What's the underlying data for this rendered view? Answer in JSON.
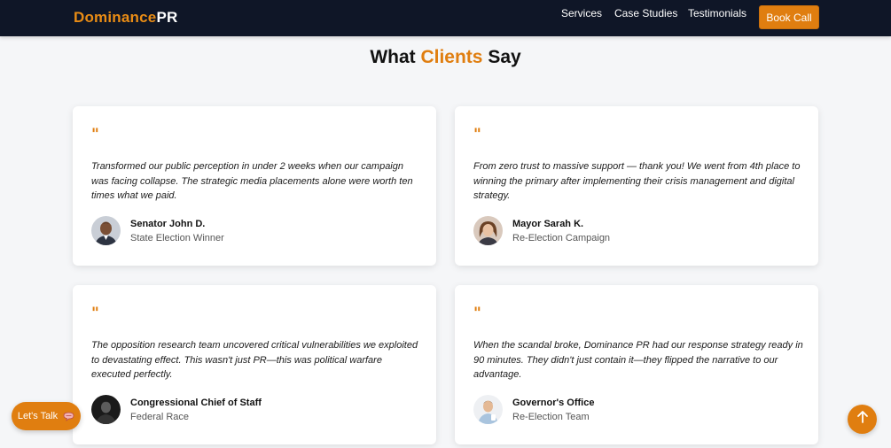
{
  "nav": {
    "logo_part1": "Dominance",
    "logo_part2": "PR",
    "links": [
      "Services",
      "Case Studies",
      "Testimonials"
    ],
    "cta_label": "Book Call"
  },
  "section": {
    "title_before": "What ",
    "title_accent": "Clients",
    "title_after": " Say"
  },
  "testimonials": [
    {
      "quote_mark": "\"",
      "quote": "Transformed our public perception in under 2 weeks when our campaign was facing collapse. The strategic media placements alone were worth ten times what we paid.",
      "name": "Senator John D.",
      "role": "State Election Winner"
    },
    {
      "quote_mark": "\"",
      "quote": "From zero trust to massive support — thank you! We went from 4th place to winning the primary after implementing their crisis management and digital strategy.",
      "name": "Mayor Sarah K.",
      "role": "Re-Election Campaign"
    },
    {
      "quote_mark": "\"",
      "quote": "The opposition research team uncovered critical vulnerabilities we exploited to devastating effect. This wasn't just PR—this was political warfare executed perfectly.",
      "name": "Congressional Chief of Staff",
      "role": "Federal Race"
    },
    {
      "quote_mark": "\"",
      "quote": "When the scandal broke, Dominance PR had our response strategy ready in 90 minutes. They didn't just contain it—they flipped the narrative to our advantage.",
      "name": "Governor's Office",
      "role": "Re-Election Team"
    }
  ],
  "floating": {
    "lets_talk_label": "Let's Talk",
    "lets_talk_icon": "chat-bubble-icon",
    "scroll_top_icon": "arrow-up-icon"
  },
  "colors": {
    "accent": "#e07e10",
    "navbar_bg": "#0f1627",
    "page_bg": "#f5f6f8"
  }
}
